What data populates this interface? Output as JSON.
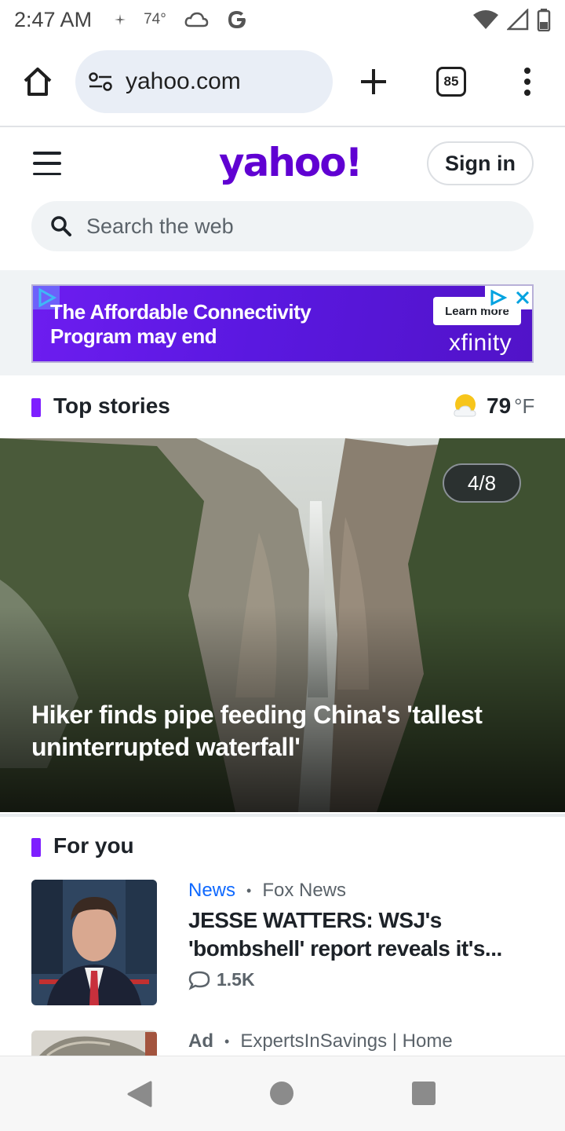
{
  "status_bar": {
    "time": "2:47 AM",
    "temperature": "74°",
    "icons": [
      "sparkle-icon",
      "cloud-icon",
      "google-g-icon",
      "wifi-icon",
      "signal-icon",
      "battery-icon"
    ]
  },
  "browser": {
    "url": "yahoo.com",
    "tab_count": "85",
    "icons": [
      "home-icon",
      "site-settings-icon",
      "plus-icon",
      "more-vert-icon"
    ]
  },
  "header": {
    "logo": "yahoo!",
    "sign_in": "Sign in",
    "search_placeholder": "Search the web",
    "brand_color": "#6001d2"
  },
  "ad_banner": {
    "headline": "The Affordable Connectivity Program may end",
    "cta": "Learn more",
    "brand": "xfinity",
    "background_color": "#5a18e0"
  },
  "top_stories": {
    "title": "Top stories",
    "weather_temp": "79",
    "weather_unit": "°F",
    "weather_icon": "partly-sunny-icon",
    "hero": {
      "counter": "4/8",
      "headline": "Hiker finds pipe feeding China's 'tallest uninterrupted waterfall'"
    }
  },
  "for_you": {
    "title": "For you",
    "stories": [
      {
        "category": "News",
        "source": "Fox News",
        "headline": "JESSE WATTERS: WSJ's 'bombshell' report reveals it's...",
        "comments": "1.5K"
      }
    ],
    "ad": {
      "label": "Ad",
      "source": "ExpertsInSavings | Home"
    }
  },
  "accent_color": "#7e1fff",
  "link_color": "#0f69ff"
}
